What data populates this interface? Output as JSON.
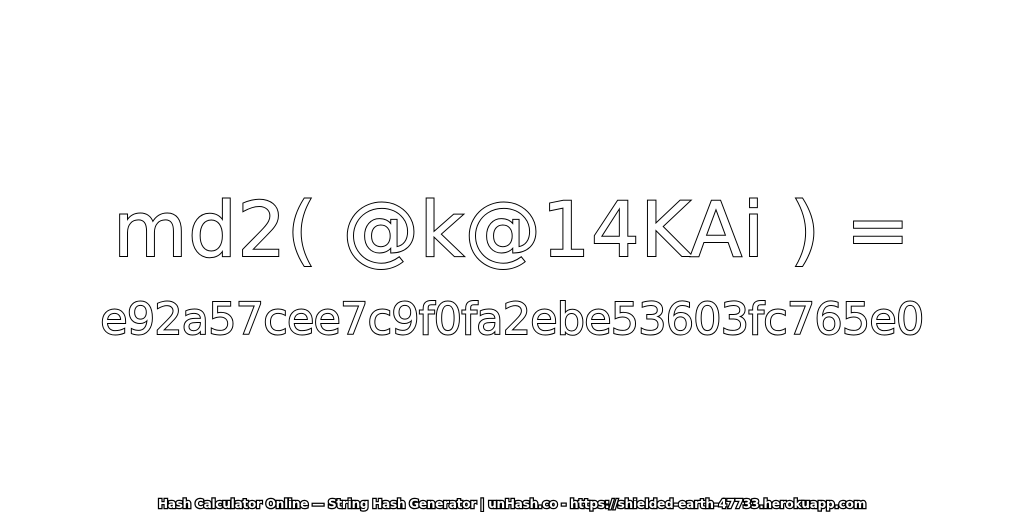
{
  "expression": "md2( @k@14KAi ) =",
  "hash_value": "e92a57cee7c9f0fa2ebe53603fc765e0",
  "footer": "Hash Calculator Online — String Hash Generator | unHash.co - https://shielded-earth-47733.herokuapp.com",
  "colors": {
    "background": "#ffffff",
    "text_fill": "#ffffff",
    "text_outline": "#000000"
  }
}
